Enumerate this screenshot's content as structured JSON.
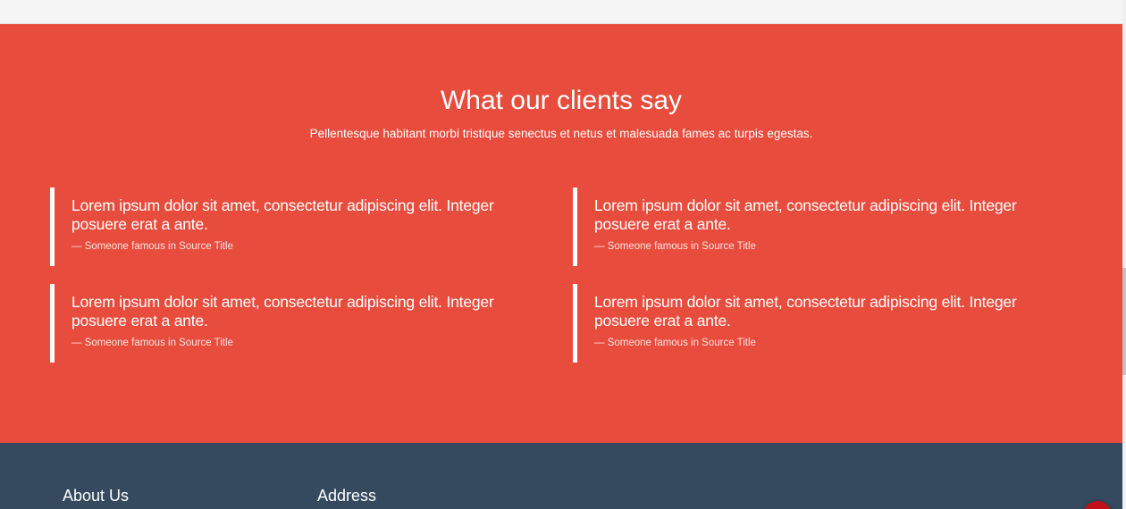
{
  "testimonials": {
    "title": "What our clients say",
    "subtitle": "Pellentesque habitant morbi tristique senectus et netus et malesuada fames ac turpis egestas.",
    "background_color": "#e84c3d",
    "quotes": [
      {
        "text": "Lorem ipsum dolor sit amet, consectetur adipiscing elit. Integer posuere erat a ante.",
        "source": "— Someone famous in Source Title"
      },
      {
        "text": "Lorem ipsum dolor sit amet, consectetur adipiscing elit. Integer posuere erat a ante.",
        "source": "— Someone famous in Source Title"
      },
      {
        "text": "Lorem ipsum dolor sit amet, consectetur adipiscing elit. Integer posuere erat a ante.",
        "source": "— Someone famous in Source Title"
      },
      {
        "text": "Lorem ipsum dolor sit amet, consectetur adipiscing elit. Integer posuere erat a ante.",
        "source": "— Someone famous in Source Title"
      }
    ]
  },
  "footer": {
    "background_color": "#354a5f",
    "about_heading": "About Us",
    "address_heading": "Address"
  },
  "scroll_top_button": {
    "icon": "chevron-up-icon",
    "color": "#c0111a"
  }
}
